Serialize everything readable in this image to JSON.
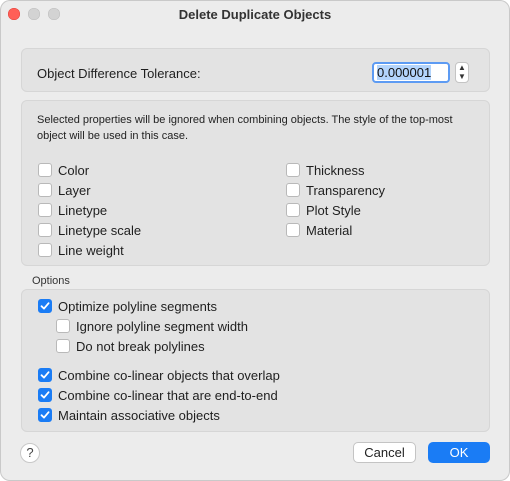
{
  "window": {
    "title": "Delete Duplicate Objects"
  },
  "tolerance": {
    "label": "Object Difference Tolerance:",
    "value": "0.000001"
  },
  "properties": {
    "description": "Selected properties will be ignored when combining objects. The style of the top-most object will be used in this case.",
    "items": [
      {
        "label": "Color",
        "checked": false
      },
      {
        "label": "Layer",
        "checked": false
      },
      {
        "label": "Linetype",
        "checked": false
      },
      {
        "label": "Linetype scale",
        "checked": false
      },
      {
        "label": "Line weight",
        "checked": false
      },
      {
        "label": "Thickness",
        "checked": false
      },
      {
        "label": "Transparency",
        "checked": false
      },
      {
        "label": "Plot Style",
        "checked": false
      },
      {
        "label": "Material",
        "checked": false
      }
    ]
  },
  "options": {
    "label": "Options",
    "items": [
      {
        "label": "Optimize polyline segments",
        "checked": true
      },
      {
        "label": "Ignore polyline segment width",
        "checked": false
      },
      {
        "label": "Do not break polylines",
        "checked": false
      },
      {
        "label": "Combine co-linear objects that overlap",
        "checked": true
      },
      {
        "label": "Combine co-linear that are end-to-end",
        "checked": true
      },
      {
        "label": "Maintain associative objects",
        "checked": true
      }
    ]
  },
  "footer": {
    "help_label": "?",
    "cancel_label": "Cancel",
    "ok_label": "OK"
  },
  "colors": {
    "accent": "#1a7cf5",
    "close": "#ff5f57"
  }
}
